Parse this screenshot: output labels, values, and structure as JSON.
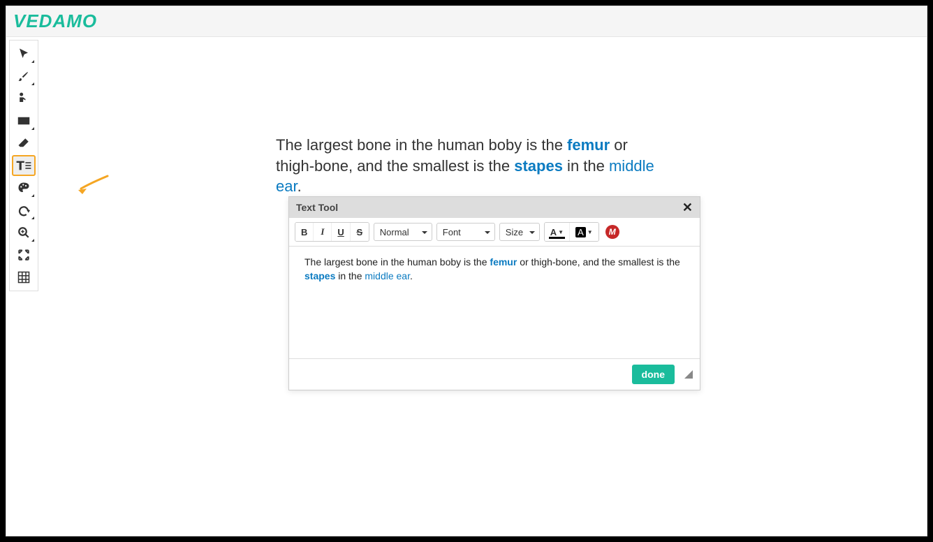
{
  "brand": "VEDAMO",
  "canvas": {
    "t1": "The largest bone in the human boby is the ",
    "kw1": "femur",
    "t2": " or thigh-bone, and the smallest is the ",
    "kw2": "stapes",
    "t3": " in the ",
    "kw3": "middle ear",
    "t4": "."
  },
  "popup": {
    "title": "Text Tool",
    "format_dropdown": "Normal",
    "font_dropdown": "Font",
    "size_dropdown": "Size",
    "done": "done",
    "content": {
      "t1": "The largest bone in the human boby is the ",
      "kw1": "femur",
      "t2": " or thigh-bone, and the smallest is the ",
      "kw2": "stapes",
      "t3": " in the ",
      "kw3": "middle ear",
      "t4": "."
    }
  },
  "tools": {
    "select": "select",
    "brush": "brush",
    "presenter": "presenter",
    "rectangle": "rectangle",
    "eraser": "eraser",
    "text": "text",
    "palette": "palette",
    "undo": "undo",
    "zoom": "zoom",
    "fit": "fit",
    "grid": "grid"
  }
}
